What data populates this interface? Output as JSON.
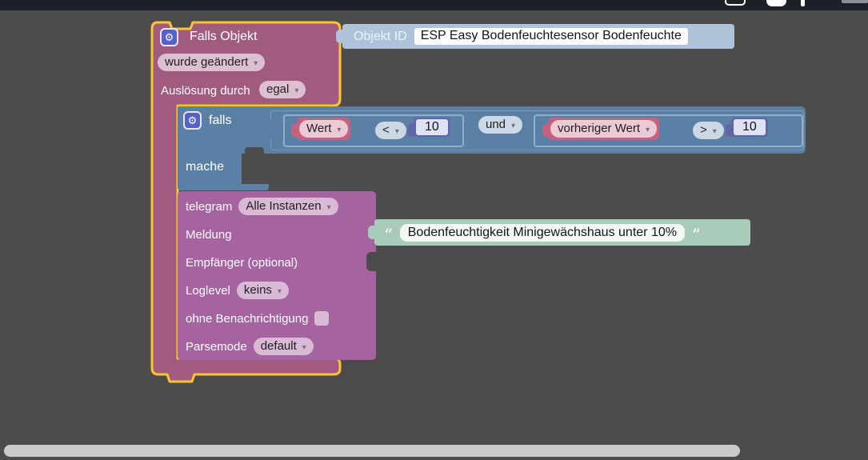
{
  "colors": {
    "workspace": "#4c4c4c",
    "topbar": "#1d2127",
    "selection_gold": "#fdc331",
    "trigger_mauve": "#a05b7e",
    "logic_blue": "#5b80a5",
    "value_pink": "#c4627f",
    "number_indigo": "#6066a7",
    "telegram_purple": "#a5639f",
    "objektid_steel": "#aec2d9",
    "text_green": "#a9cbba"
  },
  "trigger": {
    "title": "Falls Objekt",
    "event": "wurde geändert",
    "trigger_by_label": "Auslösung durch",
    "trigger_by": "egal"
  },
  "objekt_id": {
    "label": "Objekt ID",
    "value": "ESP Easy Bodenfeuchtesensor Bodenfeuchte"
  },
  "falls": {
    "label": "falls",
    "do_label": "mache",
    "condition": {
      "operator": "und",
      "left": {
        "value": "Wert",
        "op": "<",
        "number": "10"
      },
      "right": {
        "value": "vorheriger Wert",
        "op": ">",
        "number": "10"
      }
    }
  },
  "telegram": {
    "title": "telegram",
    "instance": "Alle Instanzen",
    "message_label": "Meldung",
    "recipient_label": "Empfänger (optional)",
    "loglevel_label": "Loglevel",
    "loglevel": "keins",
    "silent_label": "ohne Benachrichtigung",
    "parsemode_label": "Parsemode",
    "parsemode": "default"
  },
  "message_text": {
    "open_quote": "“",
    "close_quote": "”",
    "value": "Bodenfeuchtigkeit Minigewächshaus unter 10%"
  }
}
